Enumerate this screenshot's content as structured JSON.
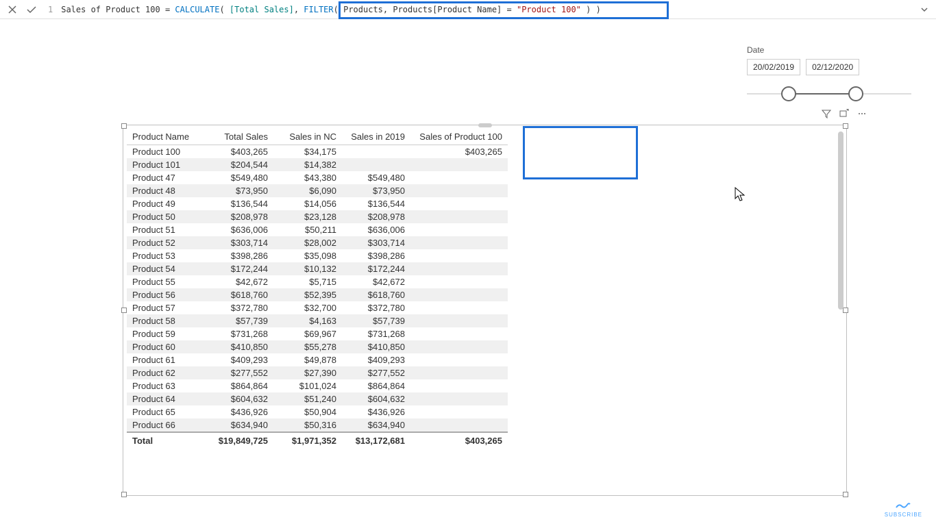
{
  "formula": {
    "line_no": "1",
    "measure_name": "Sales of Product 100",
    "eq": " = ",
    "fn_calc": "CALCULATE",
    "open1": "( ",
    "ref_total": "[Total Sales]",
    "comma": ", ",
    "fn_filter": "FILTER",
    "open2": "( ",
    "tbl": "Products",
    "comma2": ", ",
    "col": "Products[Product Name]",
    "eq2": " = ",
    "str": "\"Product 100\"",
    "close2": " ) ",
    "close1": ")"
  },
  "date_slicer": {
    "label": "Date",
    "from": "20/02/2019",
    "to": "02/12/2020"
  },
  "table": {
    "headers": [
      "Product Name",
      "Total Sales",
      "Sales in NC",
      "Sales in 2019",
      "Sales of Product 100"
    ],
    "rows": [
      {
        "c0": "Product 100",
        "c1": "$403,265",
        "c2": "$34,175",
        "c3": "",
        "c4": "$403,265"
      },
      {
        "c0": "Product 101",
        "c1": "$204,544",
        "c2": "$14,382",
        "c3": "",
        "c4": ""
      },
      {
        "c0": "Product 47",
        "c1": "$549,480",
        "c2": "$43,380",
        "c3": "$549,480",
        "c4": ""
      },
      {
        "c0": "Product 48",
        "c1": "$73,950",
        "c2": "$6,090",
        "c3": "$73,950",
        "c4": ""
      },
      {
        "c0": "Product 49",
        "c1": "$136,544",
        "c2": "$14,056",
        "c3": "$136,544",
        "c4": ""
      },
      {
        "c0": "Product 50",
        "c1": "$208,978",
        "c2": "$23,128",
        "c3": "$208,978",
        "c4": ""
      },
      {
        "c0": "Product 51",
        "c1": "$636,006",
        "c2": "$50,211",
        "c3": "$636,006",
        "c4": ""
      },
      {
        "c0": "Product 52",
        "c1": "$303,714",
        "c2": "$28,002",
        "c3": "$303,714",
        "c4": ""
      },
      {
        "c0": "Product 53",
        "c1": "$398,286",
        "c2": "$35,098",
        "c3": "$398,286",
        "c4": ""
      },
      {
        "c0": "Product 54",
        "c1": "$172,244",
        "c2": "$10,132",
        "c3": "$172,244",
        "c4": ""
      },
      {
        "c0": "Product 55",
        "c1": "$42,672",
        "c2": "$5,715",
        "c3": "$42,672",
        "c4": ""
      },
      {
        "c0": "Product 56",
        "c1": "$618,760",
        "c2": "$52,395",
        "c3": "$618,760",
        "c4": ""
      },
      {
        "c0": "Product 57",
        "c1": "$372,780",
        "c2": "$32,700",
        "c3": "$372,780",
        "c4": ""
      },
      {
        "c0": "Product 58",
        "c1": "$57,739",
        "c2": "$4,163",
        "c3": "$57,739",
        "c4": ""
      },
      {
        "c0": "Product 59",
        "c1": "$731,268",
        "c2": "$69,967",
        "c3": "$731,268",
        "c4": ""
      },
      {
        "c0": "Product 60",
        "c1": "$410,850",
        "c2": "$55,278",
        "c3": "$410,850",
        "c4": ""
      },
      {
        "c0": "Product 61",
        "c1": "$409,293",
        "c2": "$49,878",
        "c3": "$409,293",
        "c4": ""
      },
      {
        "c0": "Product 62",
        "c1": "$277,552",
        "c2": "$27,390",
        "c3": "$277,552",
        "c4": ""
      },
      {
        "c0": "Product 63",
        "c1": "$864,864",
        "c2": "$101,024",
        "c3": "$864,864",
        "c4": ""
      },
      {
        "c0": "Product 64",
        "c1": "$604,632",
        "c2": "$51,240",
        "c3": "$604,632",
        "c4": ""
      },
      {
        "c0": "Product 65",
        "c1": "$436,926",
        "c2": "$50,904",
        "c3": "$436,926",
        "c4": ""
      },
      {
        "c0": "Product 66",
        "c1": "$634,940",
        "c2": "$50,316",
        "c3": "$634,940",
        "c4": ""
      }
    ],
    "totals": {
      "label": "Total",
      "c1": "$19,849,725",
      "c2": "$1,971,352",
      "c3": "$13,172,681",
      "c4": "$403,265"
    }
  },
  "footer": {
    "subscribe": "SUBSCRIBE"
  }
}
